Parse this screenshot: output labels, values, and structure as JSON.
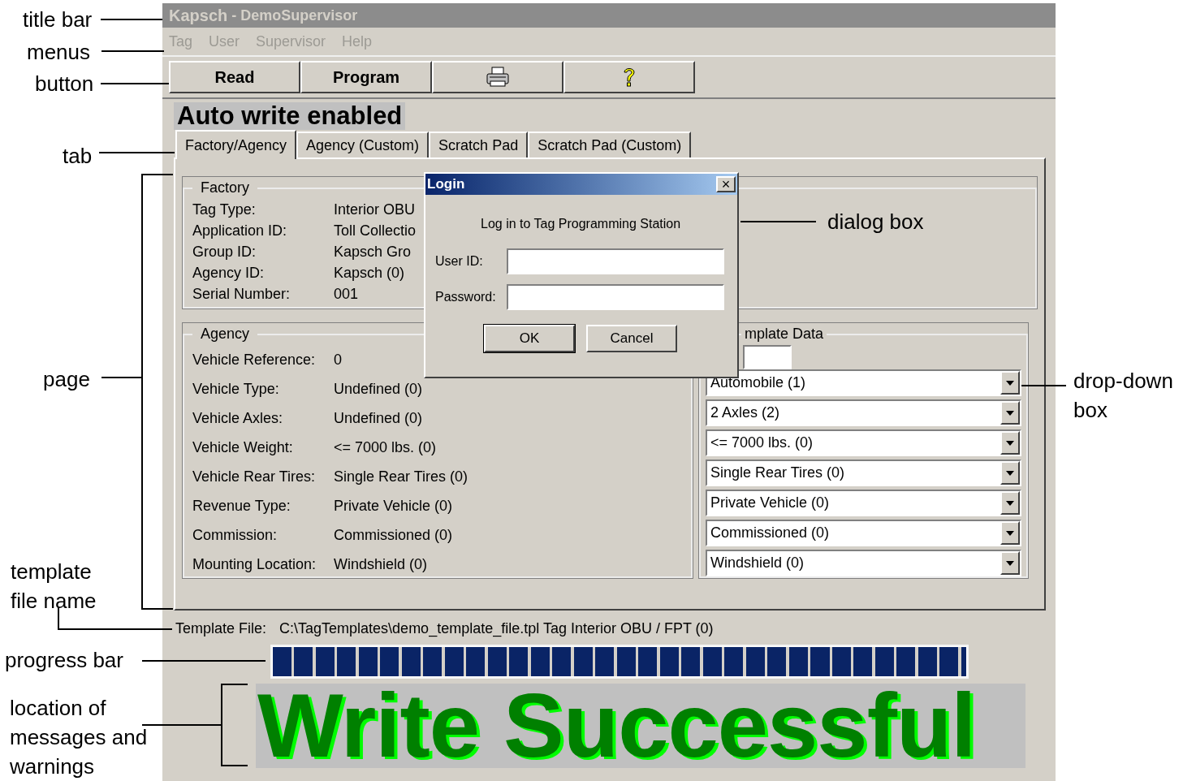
{
  "window": {
    "brand": "Kapsch",
    "title": " - DemoSupervisor"
  },
  "menus": [
    {
      "label": "Tag",
      "disabled": true
    },
    {
      "label": "User",
      "disabled": true
    },
    {
      "label": "Supervisor",
      "disabled": true
    },
    {
      "label": "Help",
      "disabled": true
    }
  ],
  "toolbar": [
    {
      "kind": "text",
      "label": "Read"
    },
    {
      "kind": "text",
      "label": "Program"
    },
    {
      "kind": "printer"
    },
    {
      "kind": "help"
    }
  ],
  "status_banner": "Auto write enabled",
  "tabs": [
    {
      "label": "Factory/Agency",
      "selected": true
    },
    {
      "label": "Agency (Custom)",
      "selected": false
    },
    {
      "label": "Scratch Pad",
      "selected": false
    },
    {
      "label": "Scratch Pad (Custom)",
      "selected": false
    }
  ],
  "factory": {
    "title": "Factory",
    "rows": [
      {
        "label": "Tag Type:",
        "value": "Interior OBU"
      },
      {
        "label": "Application ID:",
        "value": "Toll Collectio"
      },
      {
        "label": "Group ID:",
        "value": "Kapsch Gro"
      },
      {
        "label": "Agency ID:",
        "value": "Kapsch (0)"
      },
      {
        "label": "Serial Number:",
        "value": "001"
      }
    ]
  },
  "agency": {
    "title": "Agency",
    "rows": [
      {
        "label": "Vehicle Reference:",
        "value": "0"
      },
      {
        "label": "Vehicle Type:",
        "value": "Undefined (0)"
      },
      {
        "label": "Vehicle Axles:",
        "value": "Undefined (0)"
      },
      {
        "label": "Vehicle Weight:",
        "value": "<= 7000 lbs. (0)"
      },
      {
        "label": "Vehicle Rear Tires:",
        "value": "Single Rear Tires (0)"
      },
      {
        "label": "Revenue Type:",
        "value": "Private Vehicle (0)"
      },
      {
        "label": "Commission:",
        "value": "Commissioned (0)"
      },
      {
        "label": "Mounting Location:",
        "value": "Windshield (0)"
      }
    ]
  },
  "template_data": {
    "title": "mplate Data",
    "dropdowns": [
      "Automobile (1)",
      "2 Axles (2)",
      "<= 7000 lbs. (0)",
      "Single Rear Tires (0)",
      "Private Vehicle (0)",
      "Commissioned (0)",
      "Windshield (0)"
    ]
  },
  "template_file": {
    "label": "Template File:",
    "value": "C:\\TagTemplates\\demo_template_file.tpl Tag Interior OBU / FPT (0)"
  },
  "progress": {
    "level": 1
  },
  "message": "Write Successful",
  "dialog": {
    "title": "Login",
    "close": "×",
    "prompt": "Log in to Tag Programming Station",
    "fields": [
      {
        "label": "User ID:"
      },
      {
        "label": "Password:"
      }
    ],
    "buttons": [
      "OK",
      "Cancel"
    ]
  },
  "annotations": [
    "title bar",
    "menus",
    "button",
    "tab",
    "page",
    "template file name",
    "progress bar",
    "location of messages and warnings",
    "dialog box",
    "drop-down box"
  ]
}
